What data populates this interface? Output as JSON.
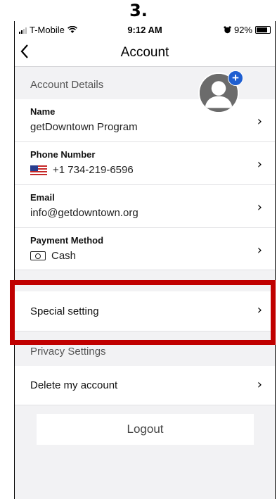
{
  "caption": "3.",
  "status": {
    "carrier": "T-Mobile",
    "time": "9:12 AM",
    "battery": "92%"
  },
  "nav": {
    "title": "Account"
  },
  "sections": {
    "account_details": "Account Details",
    "privacy_settings": "Privacy Settings"
  },
  "rows": {
    "name": {
      "label": "Name",
      "value": "getDowntown Program"
    },
    "phone": {
      "label": "Phone Number",
      "value": "+1 734-219-6596"
    },
    "email": {
      "label": "Email",
      "value": "info@getdowntown.org"
    },
    "payment": {
      "label": "Payment Method",
      "value": "Cash"
    },
    "special": {
      "label": "Special setting"
    },
    "delete": {
      "label": "Delete my account"
    }
  },
  "chevron": "›",
  "avatar_plus": "+",
  "logout": "Logout",
  "colors": {
    "highlight": "#c00000",
    "avatar_badge": "#1f5fd1",
    "background": "#f2f2f4"
  },
  "icons": [
    "wifi-icon",
    "alarm-icon",
    "battery-icon",
    "back-icon",
    "avatar-icon",
    "flag-icon",
    "cash-icon",
    "chevron-right-icon"
  ]
}
